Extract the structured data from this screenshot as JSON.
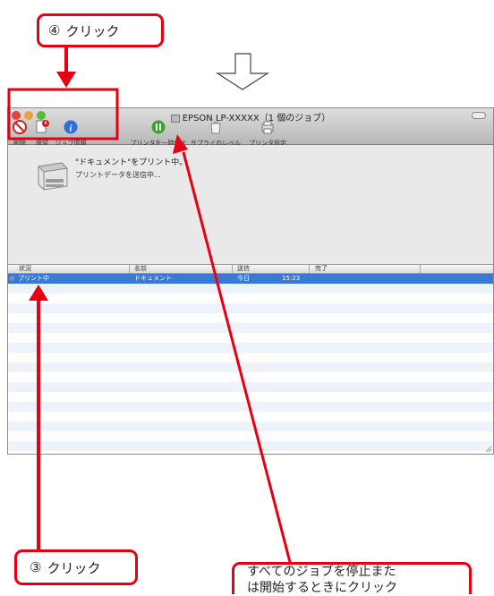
{
  "callouts": {
    "step4": {
      "number": "④",
      "label": "クリック"
    },
    "step3": {
      "number": "③",
      "label": "クリック"
    },
    "note": {
      "line1": "すべてのジョブを停止また",
      "line2": "は開始するときにクリック"
    }
  },
  "window": {
    "title": "EPSON LP-XXXXX（1 個のジョブ）",
    "toolbar": {
      "delete": "削除",
      "hold": "保留",
      "job_info": "ジョブ情報",
      "pause_printer": "プリンタを一時停止",
      "supply_levels": "サプライのレベル",
      "printer_setup": "プリンタ設定"
    },
    "status": {
      "main": "\"ドキュメント\"をプリント中。",
      "sub": "プリントデータを送信中..."
    },
    "table": {
      "headers": {
        "status": "状況",
        "name": "名前",
        "sent": "送信",
        "done": "完了"
      },
      "rows": [
        {
          "status": "プリント中",
          "name": "ドキュメント",
          "sent": "今日",
          "time": "15:23"
        }
      ]
    }
  },
  "colors": {
    "accent_red": "#e60012",
    "selection_blue": "#3a78d6"
  }
}
